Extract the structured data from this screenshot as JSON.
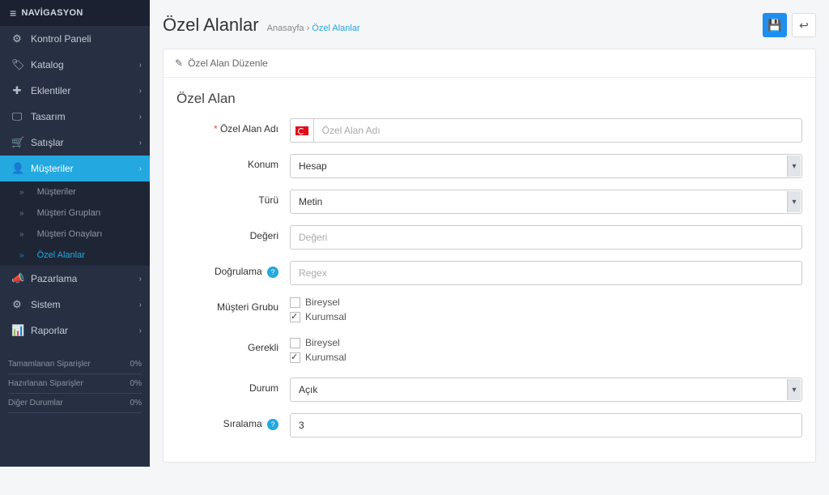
{
  "sidebar": {
    "title": "NAVİGASYON",
    "items": [
      {
        "icon": "⚙",
        "label": "Kontrol Paneli",
        "hasSub": false
      },
      {
        "icon": "🏷",
        "label": "Katalog",
        "hasSub": true
      },
      {
        "icon": "✚",
        "label": "Eklentiler",
        "hasSub": true
      },
      {
        "icon": "🖵",
        "label": "Tasarım",
        "hasSub": true
      },
      {
        "icon": "🛒",
        "label": "Satışlar",
        "hasSub": true
      },
      {
        "icon": "👤",
        "label": "Müşteriler",
        "hasSub": true,
        "active": true
      },
      {
        "icon": "📣",
        "label": "Pazarlama",
        "hasSub": true
      },
      {
        "icon": "⚙",
        "label": "Sistem",
        "hasSub": true
      },
      {
        "icon": "📊",
        "label": "Raporlar",
        "hasSub": true
      }
    ],
    "subItems": [
      {
        "label": "Müşteriler"
      },
      {
        "label": "Müşteri Grupları"
      },
      {
        "label": "Müşteri Onayları"
      },
      {
        "label": "Özel Alanlar",
        "active": true
      }
    ],
    "stats": [
      {
        "label": "Tamamlanan Siparişler",
        "value": "0%"
      },
      {
        "label": "Hazırlanan Siparişler",
        "value": "0%"
      },
      {
        "label": "Diğer Durumlar",
        "value": "0%"
      }
    ]
  },
  "header": {
    "title": "Özel Alanlar",
    "crumb1": "Anasayfa",
    "crumb2": "Özel Alanlar"
  },
  "panel": {
    "title": "Özel Alan Düzenle",
    "sectionTitle": "Özel Alan"
  },
  "form": {
    "nameLabel": "Özel Alan Adı",
    "namePlaceholder": "Özel Alan Adı",
    "locationLabel": "Konum",
    "locationValue": "Hesap",
    "typeLabel": "Türü",
    "typeValue": "Metin",
    "valueLabel": "Değeri",
    "valuePlaceholder": "Değeri",
    "validationLabel": "Doğrulama",
    "validationPlaceholder": "Regex",
    "customerGroupLabel": "Müşteri Grubu",
    "requiredLabel": "Gerekli",
    "statusLabel": "Durum",
    "statusValue": "Açık",
    "sortLabel": "Sıralama",
    "sortValue": "3",
    "groupOptions": [
      {
        "label": "Bireysel",
        "checked": false
      },
      {
        "label": "Kurumsal",
        "checked": true
      }
    ]
  }
}
